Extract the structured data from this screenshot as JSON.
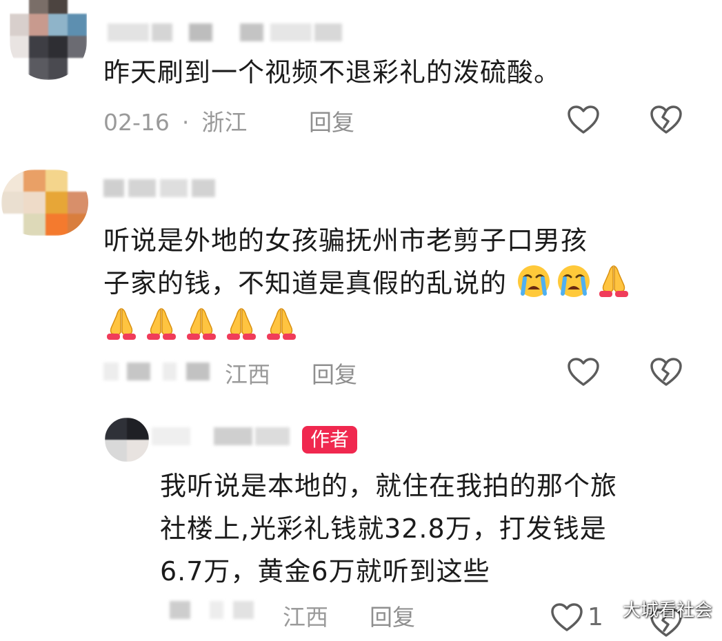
{
  "comments": [
    {
      "text_lines": [
        "昨天刷到一个视频不退彩礼的泼硫酸。"
      ],
      "date": "02-16",
      "location": "浙江",
      "reply_label": "回复"
    },
    {
      "text_lines": [
        "听说是外地的女孩骗抚州市老剪子口男孩",
        "子家的钱，不知道是真假的乱说的"
      ],
      "emojis_line2": [
        "crying-face-icon",
        "crying-face-icon",
        "folded-hands-icon"
      ],
      "emojis_line3": [
        "folded-hands-icon",
        "folded-hands-icon",
        "folded-hands-icon",
        "folded-hands-icon",
        "folded-hands-icon"
      ],
      "location": "江西",
      "reply_label": "回复"
    },
    {
      "badge": "作者",
      "text_lines": [
        "我听说是本地的，就住在我拍的那个旅",
        "社楼上,光彩礼钱就32.8万，打发钱是",
        "6.7万，黄金6万就听到这些"
      ],
      "location": "江西",
      "reply_label": "回复",
      "like_count": "1"
    }
  ],
  "watermark": "大城看社会",
  "colors": {
    "text": "#1b1b1b",
    "meta": "#9a9a9a",
    "badge": "#f0284f",
    "icon_stroke": "#5c5c5c"
  }
}
